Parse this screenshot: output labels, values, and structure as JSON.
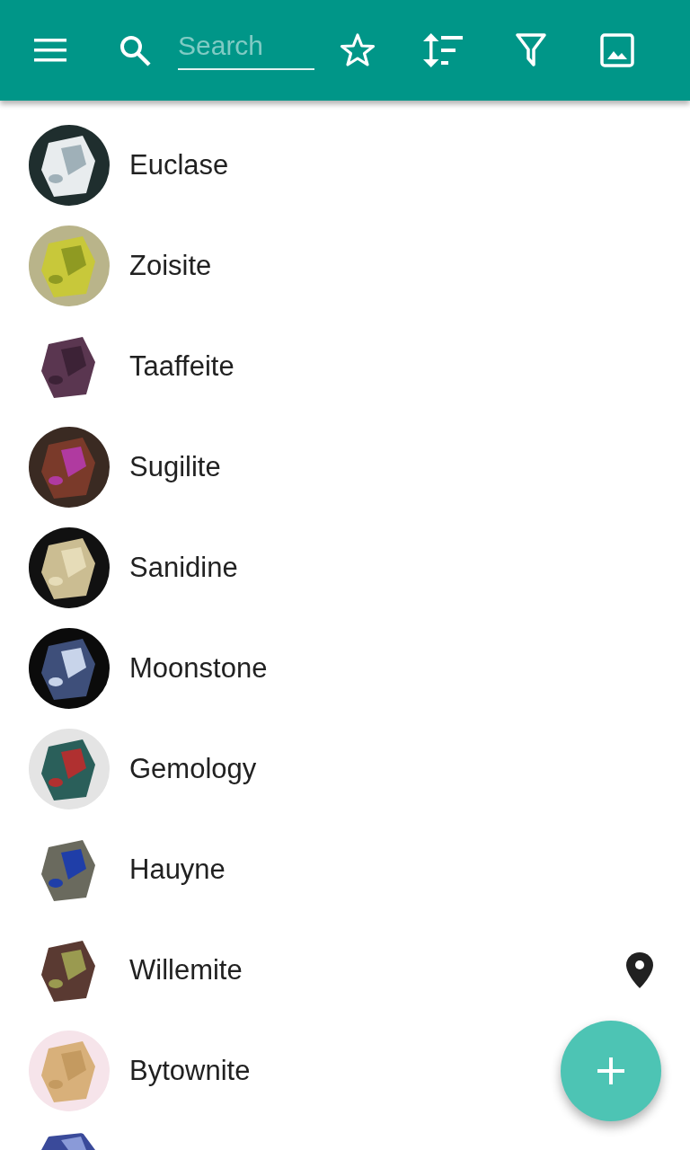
{
  "toolbar": {
    "search": {
      "placeholder": "Search"
    }
  },
  "items": [
    {
      "name": "Euclase",
      "location": false
    },
    {
      "name": "Zoisite",
      "location": false
    },
    {
      "name": "Taaffeite",
      "location": false
    },
    {
      "name": "Sugilite",
      "location": false
    },
    {
      "name": "Sanidine",
      "location": false
    },
    {
      "name": "Moonstone",
      "location": false
    },
    {
      "name": "Gemology",
      "location": false
    },
    {
      "name": "Hauyne",
      "location": false
    },
    {
      "name": "Willemite",
      "location": true
    },
    {
      "name": "Bytownite",
      "location": false
    },
    {
      "kind": "picture",
      "location": false
    }
  ]
}
